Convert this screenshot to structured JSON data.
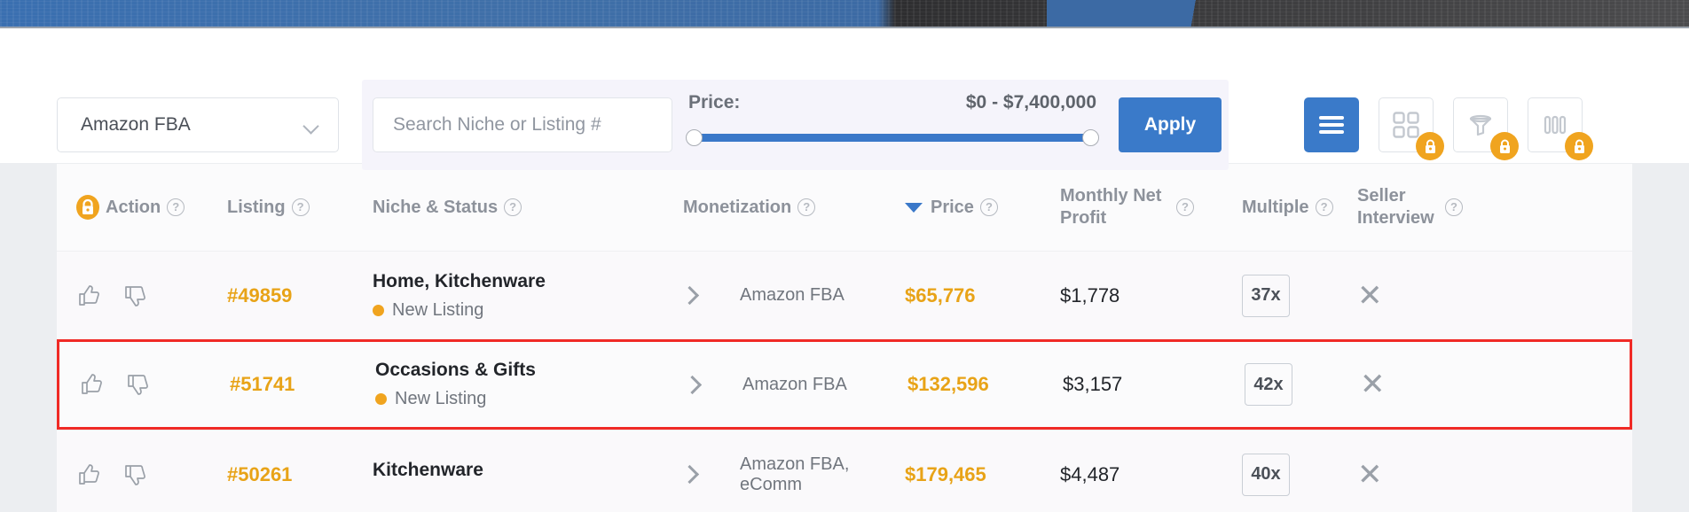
{
  "hero": {
    "name": "skyline-banner"
  },
  "filters": {
    "marketplace_select": {
      "value": "Amazon FBA",
      "icon": "chevron-down-icon"
    },
    "search": {
      "placeholder": "Search Niche or Listing #",
      "value": ""
    },
    "price": {
      "label": "Price:",
      "range_text": "$0 - $7,400,000",
      "min": 0,
      "max": 7400000
    },
    "apply_label": "Apply",
    "views": [
      {
        "name": "list-view",
        "icon": "list-icon",
        "active": true,
        "locked": false
      },
      {
        "name": "grid-view",
        "icon": "grid-icon",
        "active": false,
        "locked": true
      },
      {
        "name": "funnel-view",
        "icon": "funnel-icon",
        "active": false,
        "locked": true
      },
      {
        "name": "columns-view",
        "icon": "columns-icon",
        "active": false,
        "locked": true
      }
    ]
  },
  "table": {
    "columns": [
      {
        "label": "Action",
        "locked": true,
        "help": true,
        "sorted": false
      },
      {
        "label": "Listing",
        "locked": false,
        "help": true,
        "sorted": false
      },
      {
        "label": "Niche & Status",
        "locked": false,
        "help": true,
        "sorted": false
      },
      {
        "label": "Monetization",
        "locked": false,
        "help": true,
        "sorted": false
      },
      {
        "label": "Price",
        "locked": false,
        "help": true,
        "sorted": true,
        "sort_dir": "desc"
      },
      {
        "label": "Monthly Net Profit",
        "locked": false,
        "help": true,
        "sorted": false
      },
      {
        "label": "Multiple",
        "locked": false,
        "help": true,
        "sorted": false
      },
      {
        "label": "Seller Interview",
        "locked": false,
        "help": true,
        "sorted": false
      }
    ],
    "rows": [
      {
        "listing_id": "#49859",
        "niche": "Home, Kitchenware",
        "status": "New Listing",
        "monetization": "Amazon FBA",
        "price": "$65,776",
        "monthly_net_profit": "$1,778",
        "multiple": "37x",
        "seller_interview": "✕",
        "highlighted": false
      },
      {
        "listing_id": "#51741",
        "niche": "Occasions & Gifts",
        "status": "New Listing",
        "monetization": "Amazon FBA",
        "price": "$132,596",
        "monthly_net_profit": "$3,157",
        "multiple": "42x",
        "seller_interview": "✕",
        "highlighted": true
      },
      {
        "listing_id": "#50261",
        "niche": "Kitchenware",
        "status": "",
        "monetization": "Amazon FBA, eComm",
        "price": "$179,465",
        "monthly_net_profit": "$4,487",
        "multiple": "40x",
        "seller_interview": "✕",
        "highlighted": false
      }
    ]
  },
  "colors": {
    "accent_blue": "#3a7ac9",
    "accent_orange": "#e8a317",
    "lock_orange": "#f0a41f",
    "highlight_red": "#f02a26"
  }
}
